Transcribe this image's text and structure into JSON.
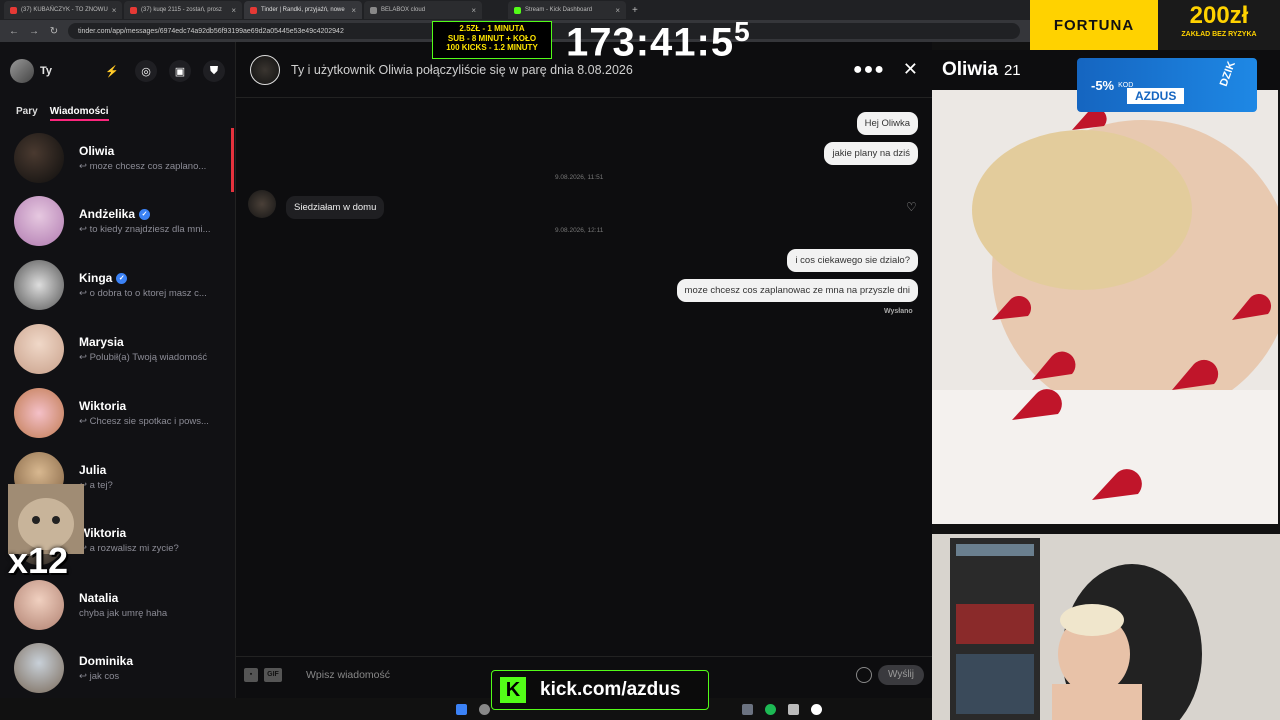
{
  "browser": {
    "tabs": [
      {
        "label": "(37) KUBAŃCZYK - TO ZNOWU"
      },
      {
        "label": "(37) kuqe 2115 - zostań, prosz"
      },
      {
        "label": "Tinder | Randki, przyjaźń, nowe"
      },
      {
        "label": "BELABOX cloud"
      },
      {
        "label": "Stream - Kick Dashboard"
      }
    ],
    "url": "tinder.com/app/messages/6974edc74a92db56f93199ae69d2a05445e53e49c4202942"
  },
  "left": {
    "me_label": "Ty",
    "tab_pary": "Pary",
    "tab_wiadomosci": "Wiadomości",
    "conversations": [
      {
        "name": "Oliwia",
        "preview": "↩ moze chcesz cos zaplano...",
        "verified": false
      },
      {
        "name": "Andżelika",
        "preview": "↩ to kiedy znajdziesz dla mni...",
        "verified": true
      },
      {
        "name": "Kinga",
        "preview": "↩ o dobra to o ktorej masz c...",
        "verified": true
      },
      {
        "name": "Marysia",
        "preview": "↩ Polubił(a) Twoją wiadomość",
        "verified": false
      },
      {
        "name": "Wiktoria",
        "preview": "↩ Chcesz sie spotkac i pows...",
        "verified": false
      },
      {
        "name": "Julia",
        "preview": "↩ a tej?",
        "verified": false
      },
      {
        "name": "Wiktoria",
        "preview": "↩ a rozwalisz mi zycie?",
        "verified": false
      },
      {
        "name": "Natalia",
        "preview": "chyba jak umrę haha",
        "verified": false
      },
      {
        "name": "Dominika",
        "preview": "↩ jak cos",
        "verified": false
      }
    ]
  },
  "chat": {
    "header": "Ty i użytkownik Oliwia połączyliście się w parę dnia 8.08.2026",
    "messages": [
      {
        "text": "Hej Oliwka",
        "dir": "out"
      },
      {
        "text": "jakie plany na dziś",
        "dir": "out"
      },
      {
        "text": "9.08.2026, 11:51",
        "dir": "stamp"
      },
      {
        "text": "Siedziałam w domu",
        "dir": "in"
      },
      {
        "text": "9.08.2026, 12:11",
        "dir": "stamp"
      },
      {
        "text": "i cos ciekawego sie dzialo?",
        "dir": "out"
      },
      {
        "text": "moze chcesz cos zaplanowac ze mna na przyszle dni",
        "dir": "out"
      }
    ],
    "sent_status": "Wysłano",
    "gif_label": "GIF",
    "input_placeholder": "Wpisz wiadomość",
    "send_label": "Wyślij"
  },
  "overlay": {
    "timer_main": "173:41:5",
    "timer_sup": "5",
    "sub_lines": [
      "2.5ZŁ - 1 MINUTA",
      "SUB - 8 MINUT + KOŁO",
      "100 KICKS - 1.2 MINUTY"
    ],
    "fortuna_brand": "FORTUNA",
    "fortuna_amount": "200zł",
    "fortuna_sub": "ZAKŁAD BEZ RYZYKA",
    "dzik_pct": "-5%",
    "dzik_kod": "KOD",
    "dzik_code": "AZDUS",
    "dzik_brand": "DZIK",
    "kick_url": "kick.com/azdus",
    "cat_count": "x12"
  },
  "profile": {
    "name": "Oliwia",
    "age": "21"
  },
  "colors": {
    "tinder_accent": "#fd267d",
    "kick_green": "#53fc18",
    "fortuna_yellow": "#ffd200"
  }
}
